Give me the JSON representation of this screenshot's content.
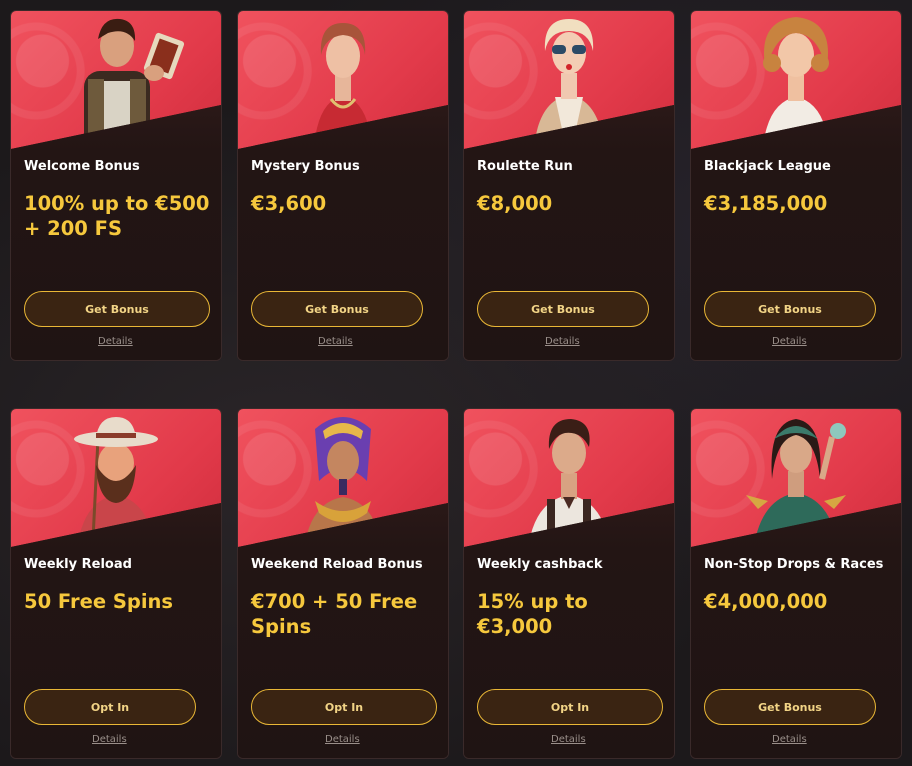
{
  "colors": {
    "accent_gold": "#f6c83d",
    "hero_red": "#e23a4a",
    "card_dark": "#231514",
    "button_border": "#e9b736"
  },
  "cards": [
    {
      "title": "Welcome Bonus",
      "amount": "100% up to €500 + 200 FS",
      "button": "Get Bonus",
      "details": "Details",
      "image": "cowboy-with-cards-illustration"
    },
    {
      "title": "Mystery Bonus",
      "amount": "€3,600",
      "button": "Get Bonus",
      "details": "Details",
      "image": "retro-woman-illustration"
    },
    {
      "title": "Roulette Run",
      "amount": "€8,000",
      "button": "Get Bonus",
      "details": "Details",
      "image": "blonde-woman-sunglasses-illustration"
    },
    {
      "title": "Blackjack League",
      "amount": "€3,185,000",
      "button": "Get Bonus",
      "details": "Details",
      "image": "curly-hair-woman-illustration"
    },
    {
      "title": "Weekly Reload",
      "amount": "50 Free Spins",
      "button": "Opt In",
      "details": "Details",
      "image": "bearded-fisherman-illustration"
    },
    {
      "title": "Weekend Reload Bonus",
      "amount": "€700 + 50 Free Spins",
      "button": "Opt In",
      "details": "Details",
      "image": "pharaoh-illustration"
    },
    {
      "title": "Weekly cashback",
      "amount": "15% up to €3,000",
      "button": "Opt In",
      "details": "Details",
      "image": "man-with-suspenders-illustration"
    },
    {
      "title": "Non-Stop Drops & Races",
      "amount": "€4,000,000",
      "button": "Get Bonus",
      "details": "Details",
      "image": "sorceress-illustration"
    }
  ]
}
